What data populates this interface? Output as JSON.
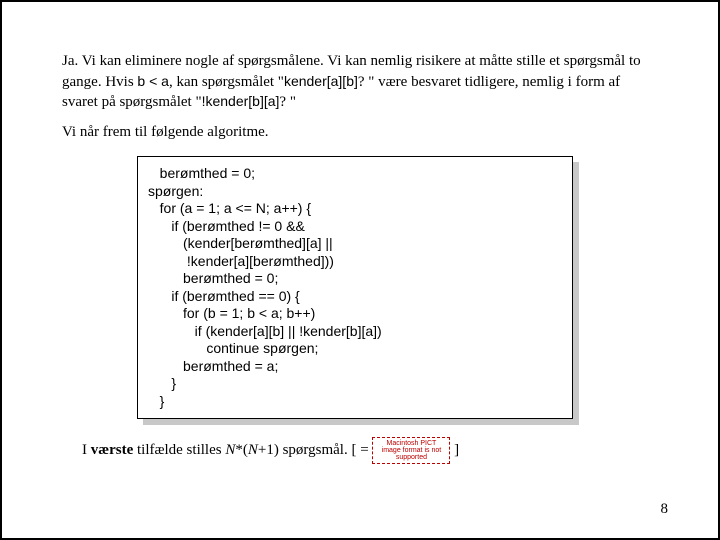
{
  "para1_pre": "Ja. Vi kan eliminere nogle af spørgsmålene. Vi kan nemlig risikere at måtte stille et spørgsmål to gange.  Hvis ",
  "para1_code1": "b < a",
  "para1_mid1": ", kan spørgsmålet \"",
  "para1_code2": "kender[a][b]",
  "para1_mid2": "? \" være besvaret tidligere, nemlig i form af svaret på spørgsmålet \"",
  "para1_code3": "!kender[b][a]",
  "para1_post": "? \"",
  "para2": "Vi når frem til følgende algoritme.",
  "code": "   berømthed = 0;\nspørgen:\n   for (a = 1; a <= N; a++) {\n      if (berømthed != 0 &&\n         (kender[berømthed][a] ||\n          !kender[a][berømthed]))\n         berømthed = 0;\n      if (berømthed == 0) {\n         for (b = 1; b < a; b++)\n            if (kender[a][b] || !kender[b][a])\n               continue spørgen;\n         berømthed = a;\n      }\n   }",
  "footer_pre": "I ",
  "footer_bold": "værste",
  "footer_mid1": " tilfælde stilles ",
  "footer_expr_i1": "N",
  "footer_expr_mid": "*(",
  "footer_expr_i2": "N",
  "footer_expr_post": "+1) spørgsmål.  [ = ",
  "footer_close": " ]",
  "pict_text": "Macintosh PICT image format is not supported",
  "pagenum": "8"
}
